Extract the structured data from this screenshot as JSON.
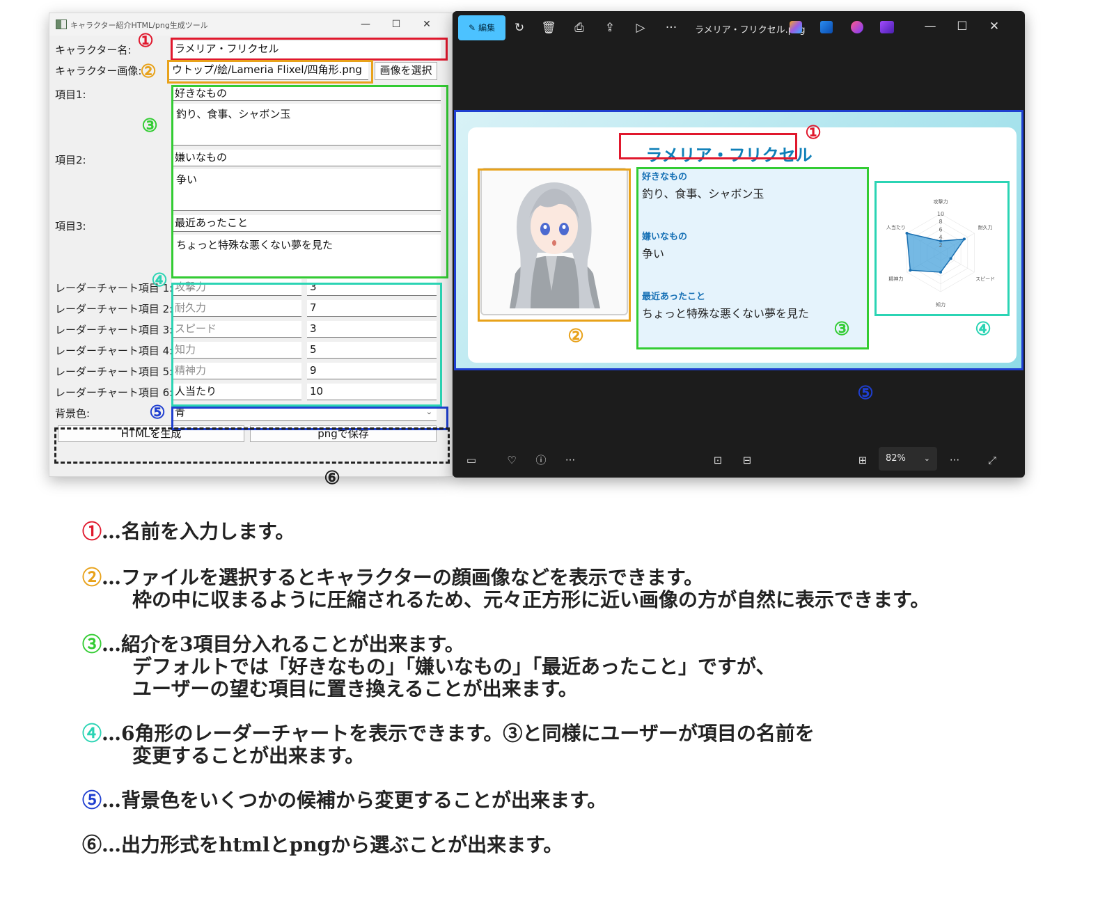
{
  "tool_window": {
    "title": "キャラクター紹介HTML/png生成ツール",
    "minimize": "—",
    "maximize": "☐",
    "close": "✕",
    "name_label": "キャラクター名:",
    "name_value": "ラメリア・フリクセル",
    "image_label": "キャラクター画像:",
    "image_path": "ウトップ/絵/Lameria Flixel/四角形.png",
    "image_button": "画像を選択",
    "items": [
      {
        "label": "項目1:",
        "heading": "好きなもの",
        "body": "釣り、食事、シャボン玉"
      },
      {
        "label": "項目2:",
        "heading": "嫌いなもの",
        "body": "争い"
      },
      {
        "label": "項目3:",
        "heading": "最近あったこと",
        "body": "ちょっと特殊な悪くない夢を見た"
      }
    ],
    "radar_rows": [
      {
        "label": "レーダーチャート項目 1:",
        "name": "攻撃力",
        "value": "3"
      },
      {
        "label": "レーダーチャート項目 2:",
        "name": "耐久力",
        "value": "7"
      },
      {
        "label": "レーダーチャート項目 3:",
        "name": "スピード",
        "value": "3"
      },
      {
        "label": "レーダーチャート項目 4:",
        "name": "知力",
        "value": "5"
      },
      {
        "label": "レーダーチャート項目 5:",
        "name": "精神力",
        "value": "9"
      },
      {
        "label": "レーダーチャート項目 6:",
        "name": "人当たり",
        "value": "10"
      }
    ],
    "bg_label": "背景色:",
    "bg_value": "青",
    "html_button": "HTMLを生成",
    "png_button": "pngで保存"
  },
  "viewer": {
    "edit_label": "編集",
    "filename": "ラメリア・フリクセル.png",
    "zoom": "82%",
    "toolbar_icons": [
      "rotate-icon",
      "delete-icon",
      "print-icon",
      "share-icon",
      "slideshow-icon",
      "more-icon"
    ],
    "card": {
      "title": "ラメリア・フリクセル",
      "items": [
        {
          "heading": "好きなもの",
          "body": "釣り、食事、シャボン玉"
        },
        {
          "heading": "嫌いなもの",
          "body": "争い"
        },
        {
          "heading": "最近あったこと",
          "body": "ちょっと特殊な悪くない夢を見た"
        }
      ]
    }
  },
  "chart_data": {
    "type": "radar",
    "axes": [
      "攻撃力",
      "耐久力",
      "スピード",
      "知力",
      "精神力",
      "人当たり"
    ],
    "ticks": [
      "2",
      "4",
      "6",
      "8",
      "10"
    ],
    "values": [
      3,
      7,
      3,
      5,
      9,
      10
    ],
    "rmax": 10,
    "fill_color": "#3b9bd8"
  },
  "markers": {
    "n1": "①",
    "n2": "②",
    "n3": "③",
    "n4": "④",
    "n5": "⑤",
    "n6": "⑥",
    "color1": "#e0182d",
    "color2": "#e8a21a",
    "color3": "#33cc33",
    "color4": "#2bd4b4",
    "color5": "#1f3fd0",
    "color6": "#222222"
  },
  "explanations": [
    {
      "num": "①",
      "lines": [
        "…名前を入力します。"
      ]
    },
    {
      "num": "②",
      "lines": [
        "…ファイルを選択するとキャラクターの顔画像などを表示できます。",
        "枠の中に収まるように圧縮されるため、元々正方形に近い画像の方が自然に表示できます。"
      ]
    },
    {
      "num": "③",
      "lines": [
        "…紹介を3項目分入れることが出来ます。",
        "デフォルトでは「好きなもの」「嫌いなもの」「最近あったこと」ですが、",
        "ユーザーの望む項目に置き換えることが出来ます。"
      ]
    },
    {
      "num": "④",
      "lines": [
        "…6角形のレーダーチャートを表示できます。③と同様にユーザーが項目の名前を",
        "変更することが出来ます。"
      ]
    },
    {
      "num": "⑤",
      "lines": [
        "…背景色をいくつかの候補から変更することが出来ます。"
      ]
    },
    {
      "num": "⑥",
      "lines": [
        "…出力形式をhtmlとpngから選ぶことが出来ます。"
      ]
    }
  ]
}
